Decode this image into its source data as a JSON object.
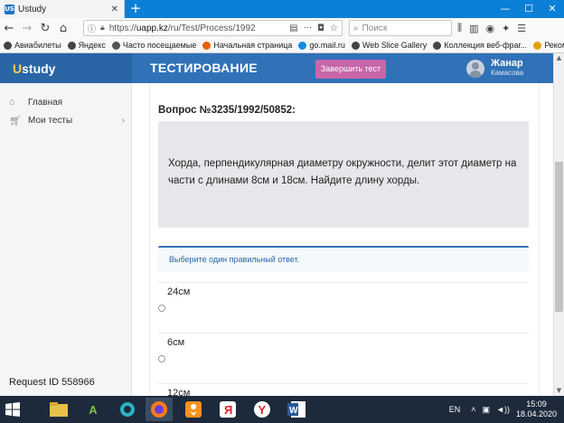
{
  "browser": {
    "tab_title": "Ustudy",
    "tab_favicon_text": "US",
    "url_prefix": "https://",
    "url_domain": "uapp.kz",
    "url_path": "/ru/Test/Process/1992",
    "search_placeholder": "Поиск",
    "bookmarks": [
      {
        "label": "Авиабилеты",
        "color": "#444444"
      },
      {
        "label": "Яндекс",
        "color": "#444444"
      },
      {
        "label": "Часто посещаемые",
        "color": "#555555"
      },
      {
        "label": "Начальная страница",
        "color": "#e66000"
      },
      {
        "label": "go.mail.ru",
        "color": "#168de2"
      },
      {
        "label": "Web Slice Gallery",
        "color": "#444444"
      },
      {
        "label": "Коллекция веб-фраг...",
        "color": "#444444"
      },
      {
        "label": "Рекомендуемые сайты",
        "color": "#e6a000"
      }
    ]
  },
  "header": {
    "logo_first": "U",
    "logo_rest": "study",
    "page_title": "ТЕСТИРОВАНИЕ",
    "finish_button": "Завершить тест",
    "user_name": "Жанар",
    "user_surname": "Камасова"
  },
  "sidebar": {
    "items": [
      {
        "label": "Главная",
        "icon": "home-icon"
      },
      {
        "label": "Мои тесты",
        "icon": "cart-icon"
      }
    ],
    "request_id": "Request ID 558966"
  },
  "question": {
    "title": "Вопрос №3235/1992/50852:",
    "text": "Хорда, перпендикулярная диаметру окружности, делит этот диаметр на части с длинами 8см и 18см. Найдите длину хорды.",
    "hint": "Выберите один правильный ответ.",
    "answers": [
      {
        "label": "24см"
      },
      {
        "label": "6см"
      },
      {
        "label": "12см"
      }
    ]
  },
  "taskbar": {
    "lang": "EN",
    "time": "15:09",
    "date": "18.04.2020"
  },
  "colors": {
    "header_blue": "#3071b8",
    "finish_button": "#c766a9",
    "logo_accent": "#ffd24a"
  }
}
